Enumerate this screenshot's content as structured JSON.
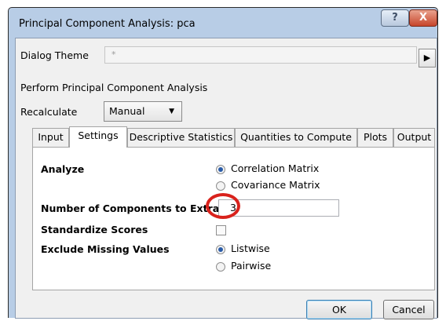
{
  "window": {
    "title": "Principal Component Analysis: pca",
    "help_label": "?",
    "close_label": "X"
  },
  "dialog_theme": {
    "label": "Dialog Theme",
    "value": "*",
    "arrow": "▶"
  },
  "section_title": "Perform Principal Component Analysis",
  "recalculate": {
    "label": "Recalculate",
    "value": "Manual"
  },
  "tabs": [
    {
      "label": "Input"
    },
    {
      "label": "Settings"
    },
    {
      "label": "Descriptive Statistics"
    },
    {
      "label": "Quantities to Compute"
    },
    {
      "label": "Plots"
    },
    {
      "label": "Output"
    }
  ],
  "active_tab": "Settings",
  "settings": {
    "analyze": {
      "label": "Analyze",
      "options": [
        "Correlation Matrix",
        "Covariance Matrix"
      ],
      "selected": "Correlation Matrix"
    },
    "components": {
      "label": "Number of Components to Extract",
      "value": "3"
    },
    "standardize": {
      "label": "Standardize Scores",
      "checked": false
    },
    "missing": {
      "label": "Exclude Missing Values",
      "options": [
        "Listwise",
        "Pairwise"
      ],
      "selected": "Listwise"
    }
  },
  "buttons": {
    "ok": "OK",
    "cancel": "Cancel"
  },
  "colors": {
    "highlight": "#d9221c",
    "titlebar": "#b8cde6",
    "close": "#c7452b"
  }
}
